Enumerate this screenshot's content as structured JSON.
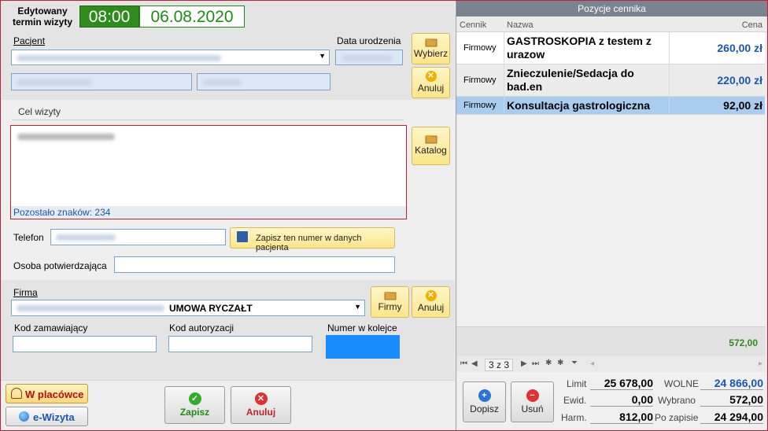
{
  "visit": {
    "edited_label": "Edytowany termin wizyty",
    "time": "08:00",
    "date": "06.08.2020"
  },
  "patient": {
    "label": "Pacjent",
    "dob_label": "Data urodzenia",
    "choose_button": "Wybierz",
    "cancel_button": "Anuluj"
  },
  "purpose": {
    "label": "Cel wizyty",
    "remaining": "Pozostało znaków: 234",
    "catalog_button": "Katalog"
  },
  "phone": {
    "label": "Telefon",
    "save_button": "Zapisz ten numer w danych pacjenta"
  },
  "confirming": {
    "label": "Osoba potwierdzająca"
  },
  "company": {
    "label": "Firma",
    "selected_value": "UMOWA RYCZAŁT",
    "companies_button": "Firmy",
    "cancel_button": "Anuluj"
  },
  "codes": {
    "ordering_label": "Kod zamawiający",
    "auth_label": "Kod autoryzacji",
    "queue_label": "Numer w kolejce"
  },
  "bottom": {
    "on_site": "W placówce",
    "e_visit": "e-Wizyta",
    "save": "Zapisz",
    "cancel": "Anuluj"
  },
  "price_list": {
    "title": "Pozycje cennika",
    "columns": {
      "cennik": "Cennik",
      "nazwa": "Nazwa",
      "cena": "Cena"
    },
    "rows": [
      {
        "cennik": "Firmowy",
        "nazwa": "GASTROSKOPIA z testem z urazow",
        "cena": "260,00 zł"
      },
      {
        "cennik": "Firmowy",
        "nazwa": "Znieczulenie/Sedacja do bad.en",
        "cena": "220,00 zł"
      },
      {
        "cennik": "Firmowy",
        "nazwa": "Konsultacja gastrologiczna",
        "cena": "92,00 zł"
      }
    ],
    "total": "572,00",
    "nav_position": "3 z 3",
    "add_button": "Dopisz",
    "remove_button": "Usuń",
    "summary": {
      "limit_label": "Limit",
      "limit_value": "25 678,00",
      "free_label": "WOLNE",
      "free_value": "24 866,00",
      "ewid_label": "Ewid.",
      "ewid_value": "0,00",
      "selected_label": "Wybrano",
      "selected_value": "572,00",
      "harm_label": "Harm.",
      "harm_value": "812,00",
      "after_label": "Po zapisie",
      "after_value": "24 294,00"
    }
  },
  "colors": {
    "time_bg": "#2e8b1e",
    "date_fg": "#1f8b14",
    "accent_blue": "#1a57b0",
    "selected_row": "#a8cdee",
    "queue_box": "#1a8cff"
  }
}
